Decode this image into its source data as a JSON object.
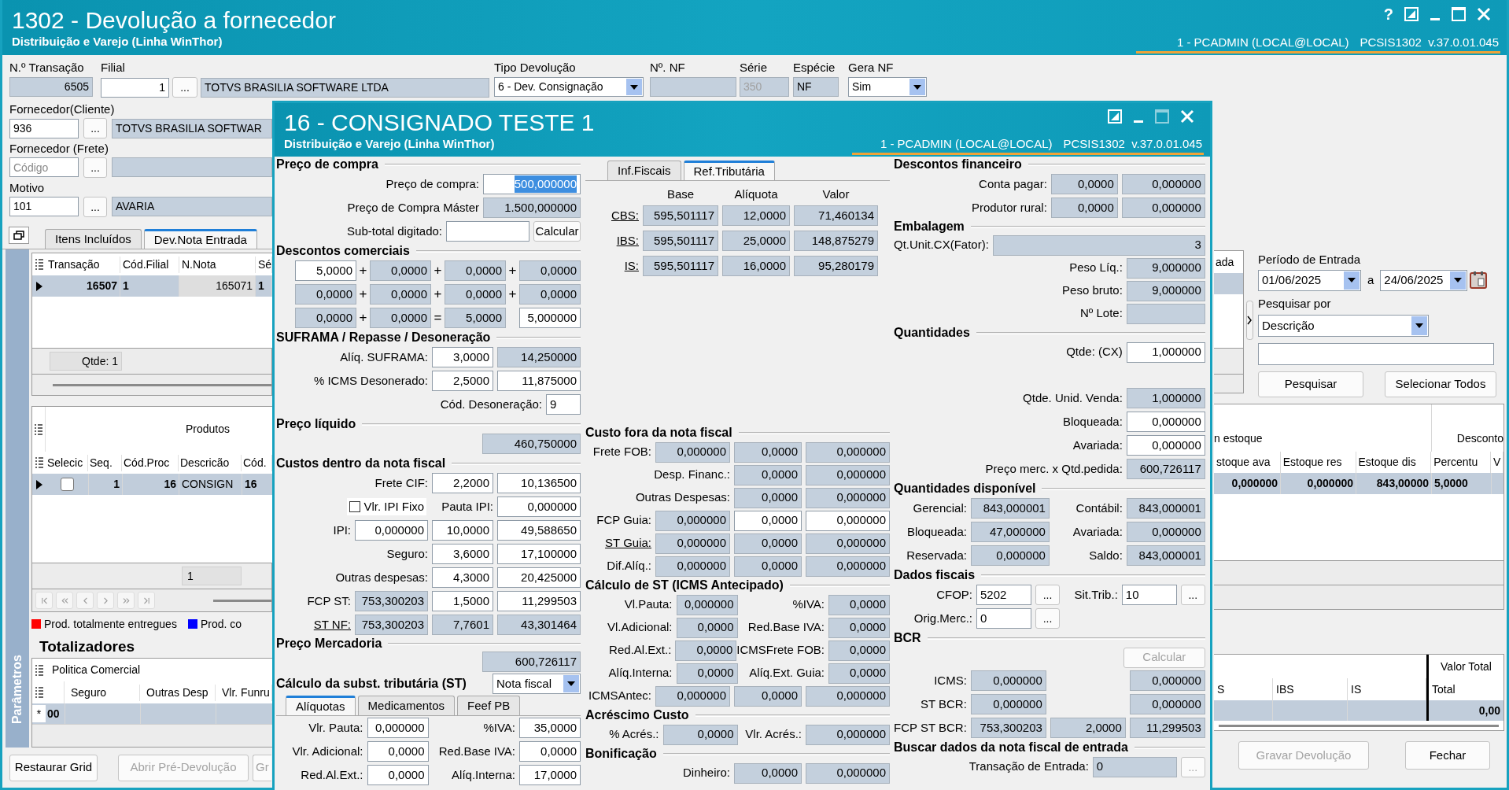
{
  "window": {
    "title": "1302 - Devolução a fornecedor",
    "subtitle": "Distribuição e Varejo (Linha WinThor)",
    "help": "?",
    "session": "1 - PCADMIN (LOCAL@LOCAL)",
    "version": "PCSIS1302  v.37.0.01.045"
  },
  "form": {
    "transacao": {
      "label": "N.º Transação",
      "value": "6505"
    },
    "filial": {
      "label": "Filial",
      "code": "1",
      "button": "...",
      "name": "TOTVS BRASILIA SOFTWARE LTDA"
    },
    "tipo_devolucao": {
      "label": "Tipo Devolução",
      "value": "6 - Dev. Consignação"
    },
    "nf": {
      "label": "Nº. NF"
    },
    "serie": {
      "label": "Série",
      "value": "350",
      "disabled": true
    },
    "especie": {
      "label": "Espécie",
      "value": "NF"
    },
    "gera_nf": {
      "label": "Gera NF",
      "value": "Sim"
    }
  },
  "left_panel": {
    "fornecedor_cliente": {
      "label": "Fornecedor(Cliente)",
      "code": "936",
      "button": "...",
      "name": "TOTVS BRASILIA SOFTWAR"
    },
    "fornecedor_frete": {
      "label": "Fornecedor (Frete)",
      "placeholder": "Código",
      "button": "..."
    },
    "motivo": {
      "label": "Motivo",
      "code": "101",
      "button": "...",
      "name": "AVARIA"
    },
    "side_tab": "Parâmetros",
    "tabs": [
      {
        "label": "Itens Incluídos",
        "selected": false
      },
      {
        "label": "Dev.Nota Entrada",
        "selected": true
      }
    ]
  },
  "notas_grid": {
    "columns": [
      "Transação",
      "Cód.Filial",
      "N.Nota",
      "Sé"
    ],
    "rows": [
      {
        "selected": true,
        "cells": [
          "16507",
          "1",
          "165071",
          "1"
        ]
      }
    ],
    "footer": "Qtde: 1"
  },
  "produtos_grid": {
    "group": "Produtos",
    "columns": [
      "Selecic",
      "Seq.",
      "Cód.Proc",
      "Descricão",
      "Cód."
    ],
    "rows": [
      {
        "selected": true,
        "checked": false,
        "cells": [
          "",
          "1",
          "16",
          "CONSIGN",
          "16"
        ]
      }
    ],
    "footer": "1"
  },
  "legend": [
    {
      "label": "Prod. totalmente entregues",
      "color": "#ff0000"
    },
    {
      "label": "Prod. co",
      "color": "#0000ff"
    }
  ],
  "totalizadores": {
    "title": "Totalizadores",
    "group": "Politica Comercial",
    "columns": [
      "Seguro",
      "Outras Desp",
      "Vlr. Funru"
    ],
    "rows": [
      {
        "marker": "*",
        "cells": [
          "00"
        ]
      }
    ]
  },
  "left_buttons": [
    {
      "label": "Restaurar Grid",
      "disabled": false
    },
    {
      "label": "Abrir Pré-Devolução",
      "disabled": true
    },
    {
      "label": "Gr",
      "disabled": true
    }
  ],
  "right_panel": {
    "fragment": {
      "column": "ada",
      "row_selected": true
    },
    "periodo": {
      "label": "Período de Entrada",
      "from": "01/06/2025",
      "separator": "a",
      "to": "24/06/2025"
    },
    "pesquisar_por": {
      "label": "Pesquisar por",
      "value": "Descrição"
    },
    "search_buttons": [
      {
        "label": "Pesquisar"
      },
      {
        "label": "Selecionar Todos"
      }
    ],
    "estoque_grid": {
      "groups": [
        "n estoque",
        "Desconto"
      ],
      "columns": [
        "stoque ava",
        "Estoque res",
        "Estoque dis",
        "Percentu",
        "V"
      ],
      "rows": [
        {
          "selected": true,
          "cells": [
            "0,000000",
            "0,000000",
            "843,00000",
            "5,0000"
          ]
        }
      ]
    },
    "totais_grid": {
      "group": "Valor Total",
      "columns": [
        "S",
        "IBS",
        "IS",
        "Total"
      ],
      "total": "0,00"
    },
    "buttons": [
      {
        "label": "Gravar Devolução",
        "disabled": true
      },
      {
        "label": "Fechar",
        "disabled": false
      }
    ]
  },
  "modal": {
    "title": "16 - CONSIGNADO TESTE 1",
    "subtitle": "Distribuição e Varejo (Linha WinThor)",
    "session": "1 - PCADMIN (LOCAL@LOCAL)",
    "version": "PCSIS1302  v.37.0.01.045",
    "left": {
      "preco_compra": {
        "title": "Preço de compra",
        "rows": [
          {
            "label": "Preço de compra:",
            "fields": [
              {
                "value": "500,000000",
                "readonly": false,
                "highlighted": true
              }
            ]
          },
          {
            "label": "Preço de Compra Máster",
            "fields": [
              {
                "value": "1.500,000000",
                "readonly": true
              }
            ]
          },
          {
            "label": "Sub-total digitado:",
            "fields": [
              {
                "readonly": false
              }
            ],
            "button": {
              "label": "Calcular",
              "disabled": false
            }
          }
        ]
      },
      "descontos_comerciais": {
        "title": "Descontos comerciais",
        "rows": [
          {
            "ops": [
              "+",
              "+",
              "+"
            ],
            "fields": [
              {
                "value": "5,0000",
                "readonly": false
              },
              {
                "value": "0,0000",
                "readonly": true
              },
              {
                "value": "0,0000",
                "readonly": true
              },
              {
                "value": "0,0000",
                "readonly": true
              }
            ]
          },
          {
            "ops": [
              "+",
              "+",
              "+"
            ],
            "fields": [
              {
                "value": "0,0000",
                "readonly": true
              },
              {
                "value": "0,0000",
                "readonly": true
              },
              {
                "value": "0,0000",
                "readonly": true
              },
              {
                "value": "0,0000",
                "readonly": true
              }
            ]
          },
          {
            "ops": [
              "+",
              "="
            ],
            "fields": [
              {
                "value": "0,0000",
                "readonly": true
              },
              {
                "value": "0,0000",
                "readonly": true
              },
              {
                "value": "5,0000",
                "readonly": true
              },
              {
                "value": "5,000000",
                "readonly": false
              }
            ]
          }
        ]
      },
      "suframa": {
        "title": "SUFRAMA / Repasse / Desoneração",
        "rows": [
          {
            "label": "Alíq. SUFRAMA:",
            "fields": [
              {
                "value": "3,0000",
                "readonly": false
              },
              {
                "value": "14,250000",
                "readonly": true
              }
            ]
          },
          {
            "label": "% ICMS Desonerado:",
            "fields": [
              {
                "value": "2,5000",
                "readonly": false
              },
              {
                "value": "11,875000",
                "readonly": false
              }
            ]
          },
          {
            "label": "Cód. Desoneração:",
            "fields": [
              {
                "value": "9",
                "readonly": false
              }
            ]
          }
        ]
      },
      "preco_liquido": {
        "title": "Preço líquido",
        "field": {
          "value": "460,750000",
          "readonly": true
        }
      },
      "custos_dentro": {
        "title": "Custos dentro da nota fiscal",
        "rows": [
          {
            "label": "Frete CIF:",
            "link": false,
            "fields": [
              {
                "value": "2,2000",
                "readonly": false
              },
              {
                "value": "10,136500",
                "readonly": false
              }
            ]
          },
          {
            "checkbox": {
              "label": "Vlr. IPI Fixo",
              "checked": false
            },
            "label": "Pauta IPI:",
            "link": false,
            "fields": [
              {
                "value": "0,000000",
                "readonly": false
              }
            ]
          },
          {
            "label": "IPI:",
            "link": false,
            "fields": [
              {
                "value": "0,000000",
                "readonly": false
              },
              {
                "value": "10,0000",
                "readonly": false
              },
              {
                "value": "49,588650",
                "readonly": false
              }
            ]
          },
          {
            "label": "Seguro:",
            "link": false,
            "fields": [
              {
                "value": "3,6000",
                "readonly": false
              },
              {
                "value": "17,100000",
                "readonly": false
              }
            ]
          },
          {
            "label": "Outras despesas:",
            "link": false,
            "fields": [
              {
                "value": "4,3000",
                "readonly": false
              },
              {
                "value": "20,425000",
                "readonly": false
              }
            ]
          },
          {
            "label": "FCP ST:",
            "link": false,
            "fields": [
              {
                "value": "753,300203",
                "readonly": true
              },
              {
                "value": "1,5000",
                "readonly": false
              },
              {
                "value": "11,299503",
                "readonly": false
              }
            ]
          },
          {
            "label": "ST NF:",
            "link": true,
            "fields": [
              {
                "value": "753,300203",
                "readonly": true
              },
              {
                "value": "7,7601",
                "readonly": true
              },
              {
                "value": "43,301464",
                "readonly": true
              }
            ]
          }
        ]
      },
      "preco_mercadoria": {
        "title": "Preço Mercadoria",
        "field": {
          "value": "600,726117",
          "readonly": true
        }
      },
      "calculo_st": {
        "title": "Cálculo da subst. tributária (ST)",
        "mode": "Nota fiscal",
        "tabs": [
          {
            "label": "Alíquotas",
            "selected": true
          },
          {
            "label": "Medicamentos",
            "selected": false
          },
          {
            "label": "Feef PB",
            "selected": false
          }
        ],
        "pairs": [
          [
            {
              "label": "Vlr. Pauta:",
              "field": {
                "value": "0,000000",
                "readonly": false
              }
            },
            {
              "label": "%IVA:",
              "field": {
                "value": "35,0000",
                "readonly": false
              }
            }
          ],
          [
            {
              "label": "Vlr. Adicional:",
              "field": {
                "value": "0,0000",
                "readonly": false
              }
            },
            {
              "label": "Red.Base IVA:",
              "field": {
                "value": "0,0000",
                "readonly": false
              }
            }
          ],
          [
            {
              "label": "Red.Al.Ext.:",
              "field": {
                "value": "0,0000",
                "readonly": false
              }
            },
            {
              "label": "Alíq.Interna:",
              "field": {
                "value": "17,0000",
                "readonly": false
              }
            }
          ]
        ]
      }
    },
    "middle": {
      "tabs": [
        {
          "label": "Inf.Fiscais",
          "selected": false
        },
        {
          "label": "Ref.Tributária",
          "selected": true
        }
      ],
      "ref_table": {
        "columns": [
          "Base",
          "Alíquota",
          "Valor"
        ],
        "rows": [
          {
            "label": "CBS:",
            "link": true,
            "fields": [
              {
                "value": "595,501117",
                "readonly": true
              },
              {
                "value": "12,0000",
                "readonly": true
              },
              {
                "value": "71,460134",
                "readonly": true
              }
            ]
          },
          {
            "label": "IBS:",
            "link": true,
            "fields": [
              {
                "value": "595,501117",
                "readonly": true
              },
              {
                "value": "25,0000",
                "readonly": true
              },
              {
                "value": "148,875279",
                "readonly": true
              }
            ]
          },
          {
            "label": "IS:",
            "link": true,
            "fields": [
              {
                "value": "595,501117",
                "readonly": true
              },
              {
                "value": "16,0000",
                "readonly": true
              },
              {
                "value": "95,280179",
                "readonly": true
              }
            ]
          }
        ]
      },
      "custo_fora": {
        "title": "Custo fora da nota fiscal",
        "rows": [
          {
            "label": "Frete FOB:",
            "link": false,
            "fields": [
              {
                "value": "0,000000",
                "readonly": true
              },
              {
                "value": "0,0000",
                "readonly": true
              },
              {
                "value": "0,000000",
                "readonly": true
              }
            ]
          },
          {
            "label": "Desp. Financ.:",
            "link": false,
            "fields": [
              {
                "value": "0,0000",
                "readonly": true
              },
              {
                "value": "0,000000",
                "readonly": true
              }
            ]
          },
          {
            "label": "Outras Despesas:",
            "link": false,
            "fields": [
              {
                "value": "0,0000",
                "readonly": true
              },
              {
                "value": "0,000000",
                "readonly": true
              }
            ]
          },
          {
            "label": "FCP Guia:",
            "link": false,
            "fields": [
              {
                "value": "0,000000",
                "readonly": true
              },
              {
                "value": "0,0000",
                "readonly": false
              },
              {
                "value": "0,000000",
                "readonly": false
              }
            ]
          },
          {
            "label": "ST Guia:",
            "link": true,
            "fields": [
              {
                "value": "0,000000",
                "readonly": true
              },
              {
                "value": "0,0000",
                "readonly": true
              },
              {
                "value": "0,000000",
                "readonly": true
              }
            ]
          },
          {
            "label": "Dif.Alíq.:",
            "link": false,
            "fields": [
              {
                "value": "0,000000",
                "readonly": true
              },
              {
                "value": "0,0000",
                "readonly": true
              },
              {
                "value": "0,000000",
                "readonly": true
              }
            ]
          }
        ]
      },
      "calculo_antecipado": {
        "title": "Cálculo de ST (ICMS Antecipado)",
        "pairs": [
          [
            {
              "label": "Vl.Pauta:",
              "field": {
                "value": "0,000000",
                "readonly": true
              }
            },
            {
              "label": "%IVA:",
              "field": {
                "value": "0,0000",
                "readonly": true
              }
            }
          ],
          [
            {
              "label": "Vl.Adicional:",
              "field": {
                "value": "0,0000",
                "readonly": true
              }
            },
            {
              "label": "Red.Base IVA:",
              "field": {
                "value": "0,0000",
                "readonly": true
              }
            }
          ],
          [
            {
              "label": "Red.Al.Ext.:",
              "field": {
                "value": "0,0000",
                "readonly": true
              }
            },
            {
              "label": "ICMSFrete FOB:",
              "field": {
                "value": "0,0000",
                "readonly": true
              }
            }
          ],
          [
            {
              "label": "Alíq.Interna:",
              "field": {
                "value": "0,0000",
                "readonly": true
              }
            },
            {
              "label": "Alíq.Ext. Guia:",
              "field": {
                "value": "0,0000",
                "readonly": true
              }
            }
          ]
        ],
        "rows": [
          {
            "label": "ICMSAntec:",
            "fields": [
              {
                "value": "0,000000",
                "readonly": true
              },
              {
                "value": "0,0000",
                "readonly": true
              },
              {
                "value": "0,000000",
                "readonly": true
              }
            ]
          }
        ]
      },
      "acrescimo": {
        "title": "Acréscimo Custo",
        "pairs": [
          [
            {
              "label": "% Acrés.:",
              "field": {
                "value": "0,0000",
                "readonly": true
              }
            },
            {
              "label": "Vlr. Acrés.:",
              "field": {
                "value": "0,000000",
                "readonly": true
              }
            }
          ]
        ]
      },
      "bonificacao": {
        "title": "Bonificação",
        "rows": [
          {
            "label": "Dinheiro:",
            "fields": [
              {
                "value": "0,0000",
                "readonly": true
              },
              {
                "value": "0,000000",
                "readonly": true
              }
            ]
          }
        ]
      }
    },
    "right": {
      "descontos_financeiro": {
        "title": "Descontos financeiro",
        "rows": [
          {
            "label": "Conta pagar:",
            "fields": [
              {
                "value": "0,0000",
                "readonly": true
              },
              {
                "value": "0,000000",
                "readonly": true
              }
            ]
          },
          {
            "label": "Produtor rural:",
            "fields": [
              {
                "value": "0,0000",
                "readonly": true
              },
              {
                "value": "0,000000",
                "readonly": true
              }
            ]
          }
        ]
      },
      "embalagem": {
        "title": "Embalagem",
        "fator": {
          "label": "Qt.Unit.CX(Fator):",
          "field": {
            "value": "3",
            "readonly": true
          }
        },
        "rows": [
          {
            "label": "Peso Líq.:",
            "fields": [
              {
                "value": "9,000000",
                "readonly": true
              }
            ]
          },
          {
            "label": "Peso bruto:",
            "fields": [
              {
                "value": "9,000000",
                "readonly": true
              }
            ]
          },
          {
            "label": "Nº Lote:",
            "fields": [
              {
                "readonly": true
              }
            ]
          }
        ]
      },
      "quantidades": {
        "title": "Quantidades",
        "qtde": {
          "label": "Qtde: (CX)",
          "fields": [
            {
              "value": "1,000000",
              "readonly": false
            }
          ]
        },
        "rows": [
          {
            "label": "Qtde. Unid. Venda:",
            "fields": [
              {
                "value": "1,000000",
                "readonly": true
              }
            ]
          },
          {
            "label": "Bloqueada:",
            "fields": [
              {
                "value": "0,000000",
                "readonly": false
              }
            ]
          },
          {
            "label": "Avariada:",
            "fields": [
              {
                "value": "0,000000",
                "readonly": false
              }
            ]
          },
          {
            "label": "Preço merc. x Qtd.pedida:",
            "fields": [
              {
                "value": "600,726117",
                "readonly": true
              }
            ]
          }
        ]
      },
      "disponivel": {
        "title": "Quantidades disponível",
        "pairs": [
          [
            {
              "label": "Gerencial:",
              "field": {
                "value": "843,000001",
                "readonly": true
              }
            },
            {
              "label": "Contábil:",
              "field": {
                "value": "843,000001",
                "readonly": true
              }
            }
          ],
          [
            {
              "label": "Bloqueada:",
              "field": {
                "value": "47,000000",
                "readonly": true
              }
            },
            {
              "label": "Avariada:",
              "field": {
                "value": "0,000000",
                "readonly": true
              }
            }
          ],
          [
            {
              "label": "Reservada:",
              "field": {
                "value": "0,000000",
                "readonly": true
              }
            },
            {
              "label": "Saldo:",
              "field": {
                "value": "843,000001",
                "readonly": true
              }
            }
          ]
        ]
      },
      "dados_fiscais": {
        "title": "Dados fiscais",
        "rows": [
          [
            {
              "label": "CFOP:",
              "field": {
                "value": "5202",
                "readonly": false
              },
              "button": "..."
            },
            {
              "label": "Sit.Trib.:",
              "field": {
                "value": "10",
                "readonly": false
              },
              "button": "..."
            }
          ],
          [
            {
              "label": "Orig.Merc.:",
              "field": {
                "value": "0",
                "readonly": false
              },
              "button": "..."
            }
          ]
        ]
      },
      "bcr": {
        "title": "BCR",
        "button": {
          "label": "Calcular",
          "disabled": true
        },
        "rows": [
          {
            "label": "ICMS:",
            "fields": [
              {
                "value": "0,000000",
                "readonly": true
              },
              {
                "value": "0,000000",
                "readonly": true
              }
            ]
          },
          {
            "label": "ST BCR:",
            "fields": [
              {
                "value": "0,000000",
                "readonly": true
              },
              {
                "value": "0,000000",
                "readonly": true
              }
            ]
          },
          {
            "label": "FCP ST BCR:",
            "fields": [
              {
                "value": "753,300203",
                "readonly": true
              },
              {
                "value": "2,0000",
                "readonly": true
              },
              {
                "value": "11,299503",
                "readonly": true
              }
            ]
          }
        ]
      },
      "buscar": {
        "title": "Buscar dados da nota fiscal de entrada",
        "label": "Transação de Entrada:",
        "field": {
          "value": "0",
          "readonly": true
        },
        "button": {
          "label": "...",
          "disabled": true
        }
      }
    }
  }
}
